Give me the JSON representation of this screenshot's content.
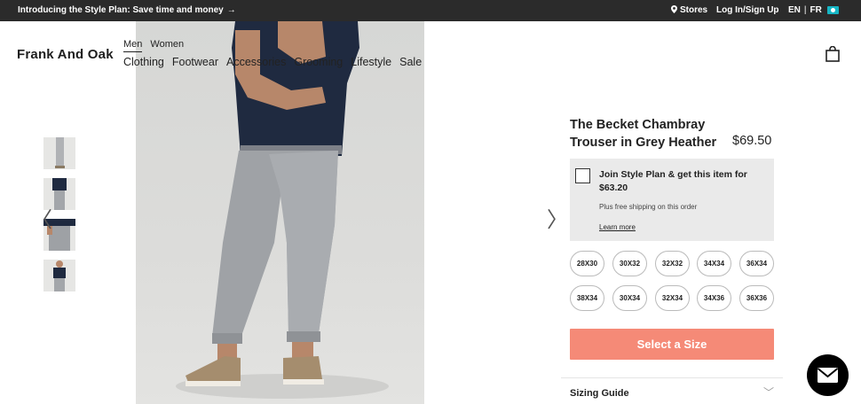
{
  "topbar": {
    "promo": "Introducing the Style Plan: Save time and money",
    "promo_arrow": "→",
    "stores": "Stores",
    "login": "Log In/Sign Up",
    "lang_en": "EN",
    "lang_sep": "|",
    "lang_fr": "FR"
  },
  "header": {
    "brand": "Frank And Oak",
    "gender": [
      "Men",
      "Women"
    ],
    "nav": [
      "Clothing",
      "Footwear",
      "Accessories",
      "Grooming",
      "Lifestyle",
      "Sale"
    ]
  },
  "gallery": {
    "arrow_left": "〈",
    "arrow_right": "〉"
  },
  "product": {
    "title": "The Becket Chambray Trouser in Grey Heather",
    "price": "$69.50",
    "plan_text": "Join Style Plan & get this item for $63.20",
    "plan_shipping": "Plus free shipping on this order",
    "learn_more": "Learn more",
    "sizes": [
      "28X30",
      "30X32",
      "32X32",
      "34X34",
      "36X34",
      "38X34",
      "30X34",
      "32X34",
      "34X36",
      "36X36"
    ],
    "select_button": "Select a Size",
    "sizing_guide": "Sizing Guide",
    "sizing_chevron": "﹀"
  },
  "colors": {
    "topbar_bg": "#2b2b2b",
    "accent_button": "#f58a77",
    "flag": "#16b6c5"
  },
  "icons": [
    "location-pin-icon",
    "shopping-bag-icon",
    "chevron-left-icon",
    "chevron-right-icon",
    "chevron-down-icon",
    "mail-icon",
    "canada-flag-icon"
  ]
}
